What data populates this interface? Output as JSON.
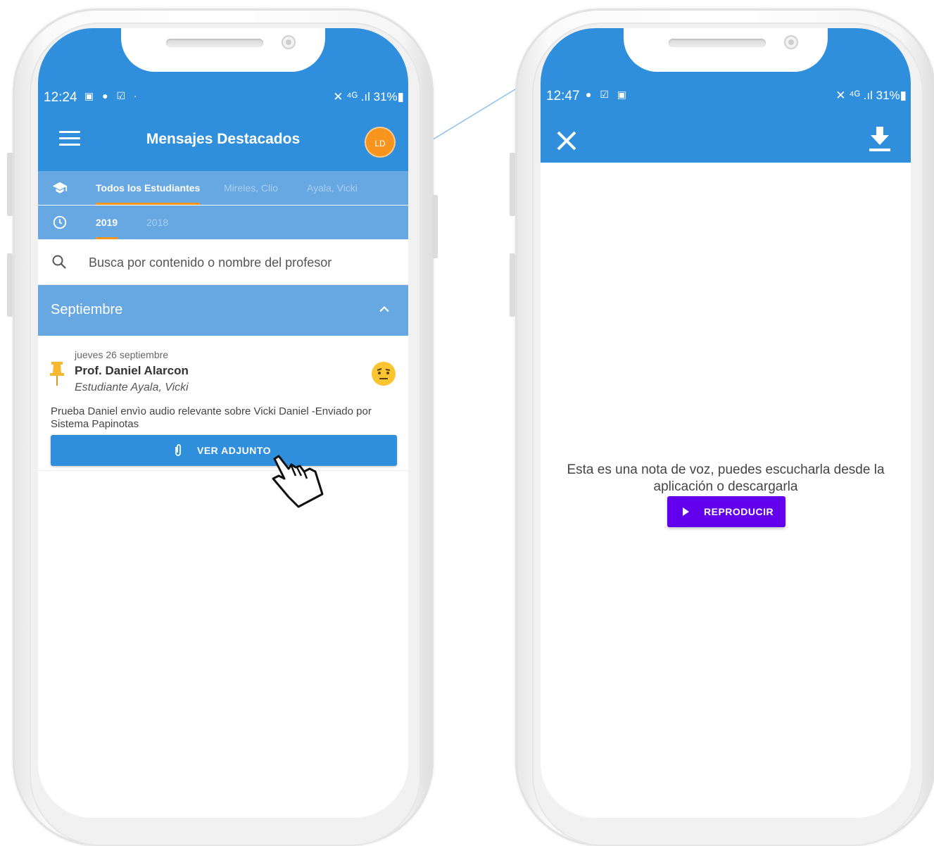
{
  "left_screen": {
    "status": {
      "time": "12:24",
      "left_icons": "▣ ● ☑ ·",
      "right_icons": "✕ ⁴ᴳ .ıl 31%▮"
    },
    "header": {
      "title": "Mensajes Destacados",
      "avatar_initials": "LD"
    },
    "student_tabs": [
      "Todos los Estudiantes",
      "Mireles, Clio",
      "Ayala, Vicki"
    ],
    "year_tabs": [
      "2019",
      "2018"
    ],
    "search": {
      "placeholder": "Busca por contenido o nombre del profesor"
    },
    "section": {
      "title": "Septiembre"
    },
    "message": {
      "date": "jueves 26 septiembre",
      "teacher": "Prof. Daniel Alarcon",
      "student": "Estudiante Ayala, Vicki",
      "body": "Prueba Daniel envìo audio relevante sobre Vicki Daniel   -Enviado por Sistema Papinotas",
      "attachment_button": "VER ADJUNTO"
    }
  },
  "right_screen": {
    "status": {
      "time": "12:47",
      "left_icons": "● ☑ ▣",
      "right_icons": "✕ ⁴ᴳ .ıl 31%▮"
    },
    "voice_message_text": "Esta es una nota de voz, puedes escucharla desde la aplicación o descargarla",
    "play_button": "REPRODUCIR"
  },
  "colors": {
    "primary": "#2f8fdc",
    "secondary": "#68a8e2",
    "accent": "#f7941d",
    "play": "#6200ee"
  }
}
